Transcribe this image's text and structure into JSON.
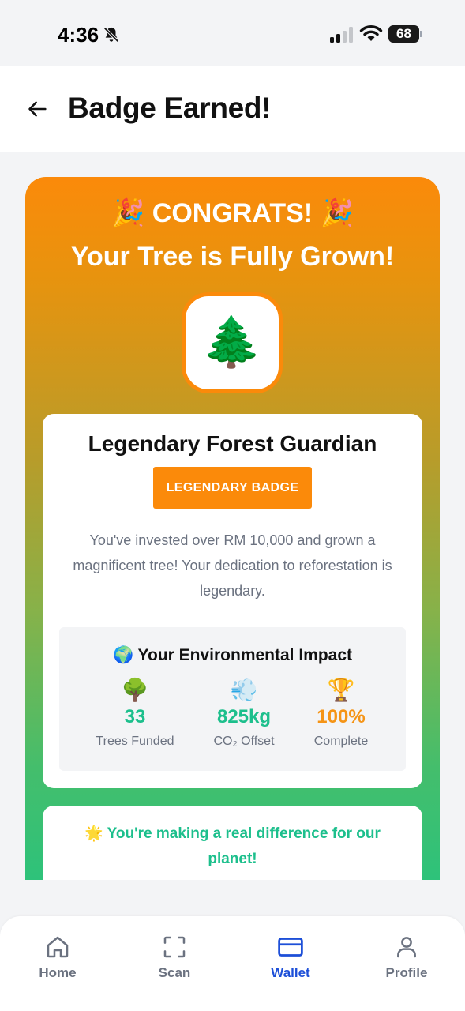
{
  "status_bar": {
    "time": "4:36",
    "battery": "68"
  },
  "header": {
    "title": "Badge Earned!"
  },
  "card": {
    "congrats": "🎉 CONGRATS! 🎉",
    "subtitle": "Your Tree is Fully Grown!",
    "tree_icon": "🌲",
    "badge_name": "Legendary Forest Guardian",
    "badge_tier": "LEGENDARY BADGE",
    "description": "You've invested over RM 10,000 and grown a magnificent tree! Your dedication to reforestation is legendary.",
    "impact": {
      "title": "🌍 Your Environmental Impact",
      "stats": [
        {
          "icon": "🌳",
          "value": "33",
          "label": "Trees Funded"
        },
        {
          "icon": "💨",
          "value": "825kg",
          "label": "CO₂ Offset"
        },
        {
          "icon": "🏆",
          "value": "100%",
          "label": "Complete"
        }
      ]
    },
    "message": "🌟 You're making a real difference for our planet!"
  },
  "nav": {
    "items": [
      {
        "label": "Home",
        "icon": "home-icon"
      },
      {
        "label": "Scan",
        "icon": "scan-icon"
      },
      {
        "label": "Wallet",
        "icon": "wallet-icon",
        "active": true
      },
      {
        "label": "Profile",
        "icon": "profile-icon"
      }
    ]
  },
  "colors": {
    "accent_orange": "#fb8a0a",
    "accent_green": "#1cbf8c",
    "active_nav": "#1d4fd8"
  }
}
